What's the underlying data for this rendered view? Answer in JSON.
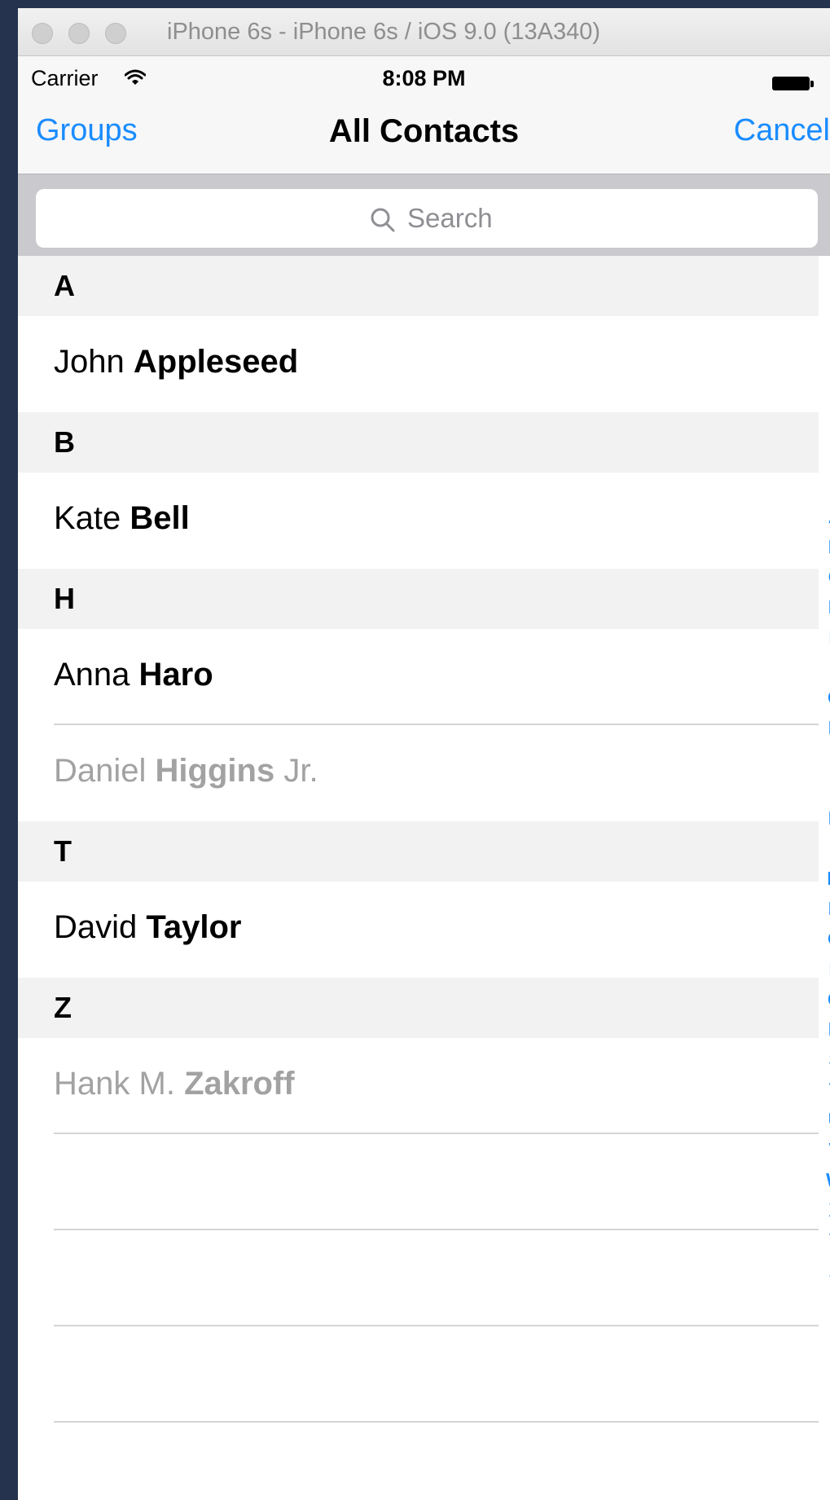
{
  "window": {
    "title": "iPhone 6s - iPhone 6s / iOS 9.0 (13A340)"
  },
  "status_bar": {
    "carrier": "Carrier",
    "time": "8:08 PM"
  },
  "nav": {
    "left_button": "Groups",
    "title": "All Contacts",
    "right_button": "Cancel"
  },
  "search": {
    "placeholder": "Search"
  },
  "sections": [
    {
      "letter": "A",
      "contacts": [
        {
          "first": "John",
          "last": "Appleseed",
          "suffix": "",
          "dimmed": false
        }
      ]
    },
    {
      "letter": "B",
      "contacts": [
        {
          "first": "Kate",
          "last": "Bell",
          "suffix": "",
          "dimmed": false
        }
      ]
    },
    {
      "letter": "H",
      "contacts": [
        {
          "first": "Anna",
          "last": "Haro",
          "suffix": "",
          "dimmed": false
        },
        {
          "first": "Daniel",
          "last": "Higgins",
          "suffix": "Jr.",
          "dimmed": true
        }
      ]
    },
    {
      "letter": "T",
      "contacts": [
        {
          "first": "David",
          "last": "Taylor",
          "suffix": "",
          "dimmed": false
        }
      ]
    },
    {
      "letter": "Z",
      "contacts": [
        {
          "first": "Hank M.",
          "last": "Zakroff",
          "suffix": "",
          "dimmed": true
        }
      ]
    }
  ],
  "section_index": [
    "A",
    "B",
    "C",
    "D",
    "E",
    "F",
    "G",
    "H",
    "I",
    "J",
    "K",
    "L",
    "M",
    "N",
    "O",
    "P",
    "Q",
    "R",
    "S",
    "T",
    "U",
    "V",
    "W",
    "X",
    "Y",
    "Z",
    "#"
  ],
  "colors": {
    "accent": "#1a8cff",
    "section_bg": "#f2f2f2",
    "dimmed_text": "#a2a2a2"
  },
  "icons": {
    "search": "search-icon",
    "wifi": "wifi-icon",
    "battery": "battery-icon"
  }
}
